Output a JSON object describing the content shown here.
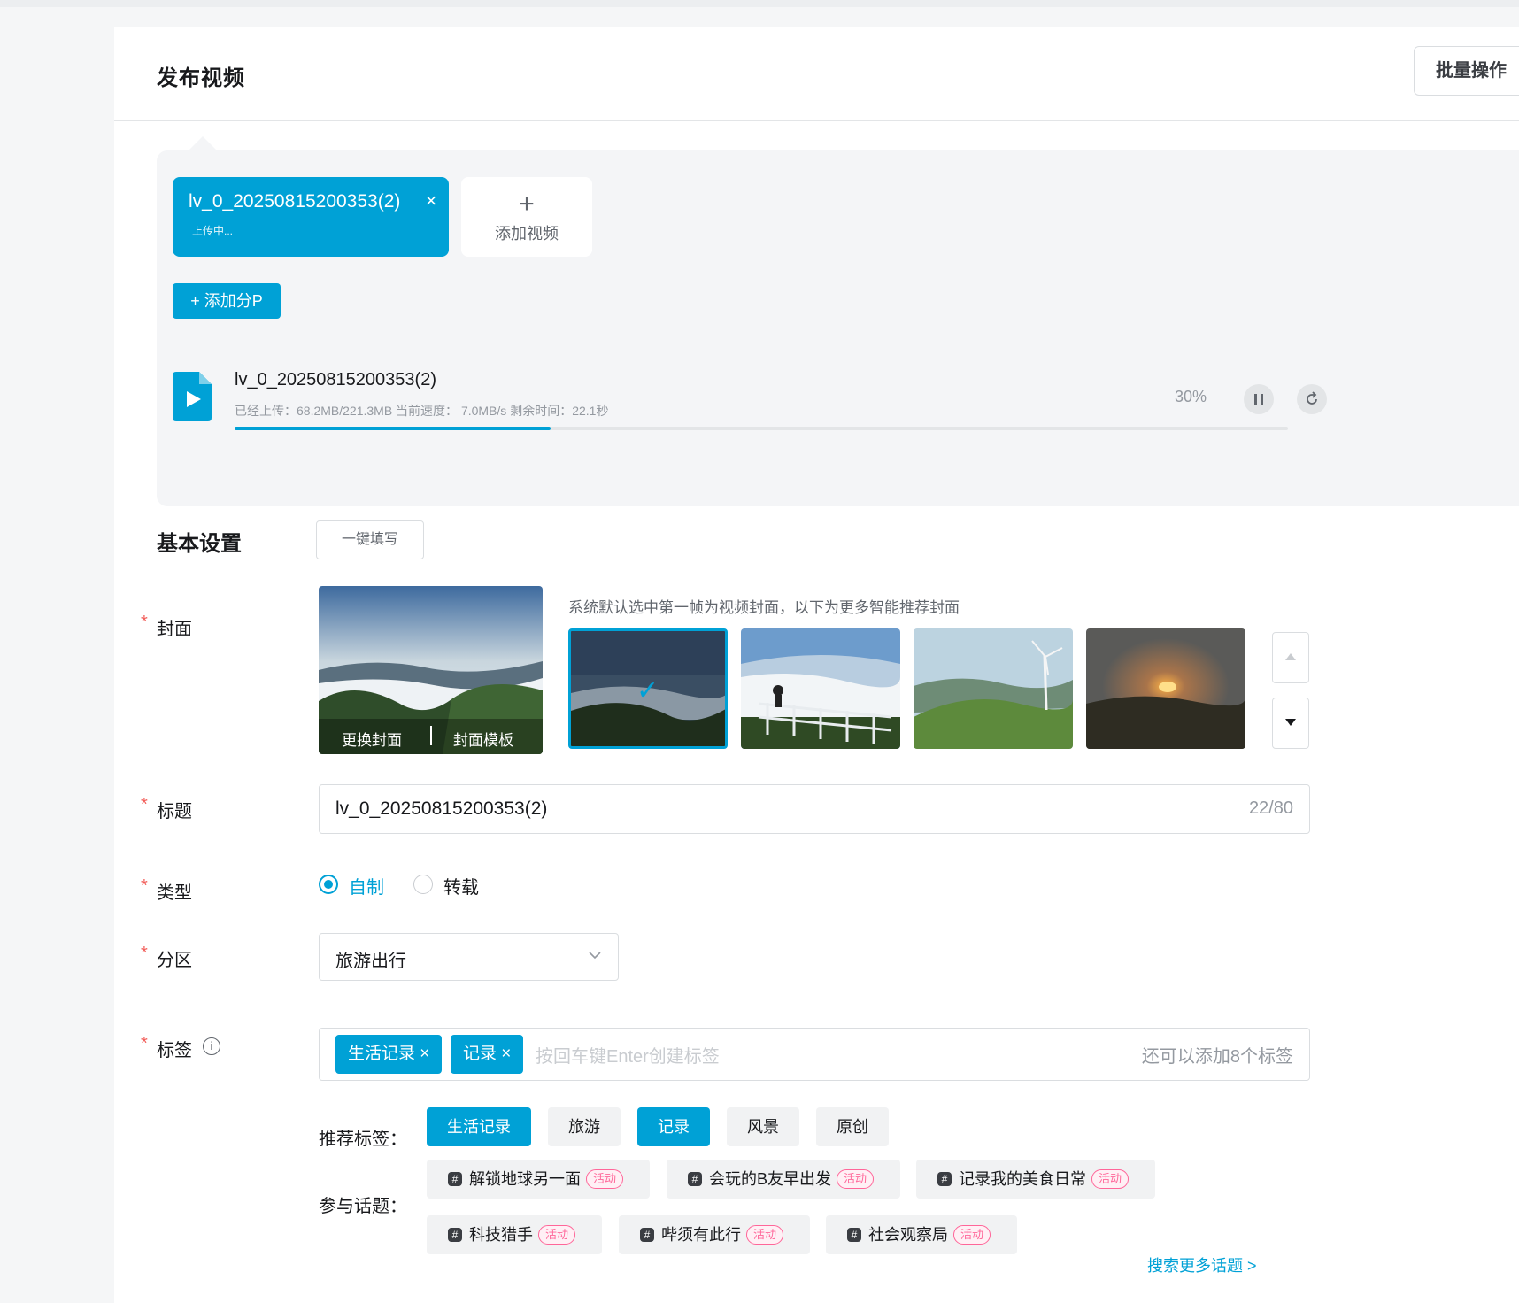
{
  "header": {
    "title": "发布视频",
    "batch_button": "批量操作"
  },
  "upload": {
    "file_tab": {
      "name": "lv_0_20250815200353(2)",
      "status": "上传中...",
      "close": "×"
    },
    "add_video": {
      "plus": "+",
      "label": "添加视频"
    },
    "add_part": "+ 添加分P",
    "progress": {
      "filename": "lv_0_20250815200353(2)",
      "info": "已经上传：68.2MB/221.3MB  当前速度：  7.0MB/s 剩余时间：22.1秒",
      "percent_text": "30%",
      "percent": 0.3,
      "pause_icon": "pause-icon",
      "retry_icon": "refresh-icon"
    }
  },
  "basic": {
    "title": "基本设置",
    "autofill": "一键填写",
    "required_mark": "*",
    "cover": {
      "label": "封面",
      "change": "更换封面",
      "template": "封面模板",
      "hint": "系统默认选中第一帧为视频封面，以下为更多智能推荐封面"
    },
    "title_field": {
      "label": "标题",
      "value": "lv_0_20250815200353(2)",
      "count": "22/80"
    },
    "type": {
      "label": "类型",
      "options": [
        "自制",
        "转载"
      ],
      "selected": "自制"
    },
    "zone": {
      "label": "分区",
      "value": "旅游出行"
    },
    "tags": {
      "label": "标签",
      "chips": [
        "生活记录 ×",
        "记录 ×"
      ],
      "placeholder": "按回车键Enter创建标签",
      "remaining": "还可以添加8个标签",
      "recommend_label": "推荐标签：",
      "recommended": [
        "生活记录",
        "旅游",
        "记录",
        "风景",
        "原创"
      ]
    },
    "topics": {
      "label": "参与话题：",
      "badge": "活动",
      "items": [
        "解锁地球另一面",
        "会玩的B友早出发",
        "记录我的美食日常",
        "科技猎手",
        "哔须有此行",
        "社会观察局"
      ],
      "more": "搜索更多话题 >"
    }
  },
  "colors": {
    "accent": "#00a1d6",
    "activity_badge": "#ff6699",
    "required": "#f25d59"
  }
}
